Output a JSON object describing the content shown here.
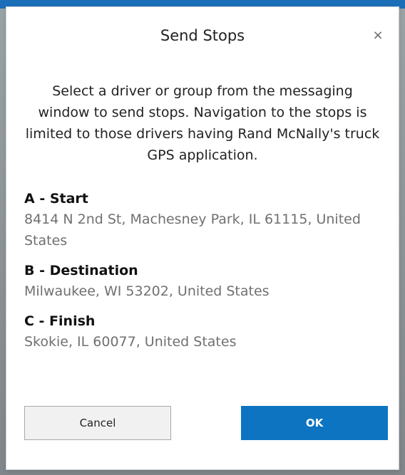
{
  "dialog": {
    "title": "Send Stops",
    "close_icon": "×",
    "message": "Select a driver or group from the messaging window to send stops. Navigation to the stops is limited to those drivers having Rand McNally's truck GPS application.",
    "stops": [
      {
        "label": "A - Start",
        "address": "8414 N 2nd St, Machesney Park, IL 61115, United States"
      },
      {
        "label": "B - Destination",
        "address": "Milwaukee, WI 53202, United States"
      },
      {
        "label": "C - Finish",
        "address": "Skokie, IL 60077, United States"
      }
    ],
    "buttons": {
      "cancel_label": "Cancel",
      "ok_label": "OK"
    }
  },
  "colors": {
    "primary": "#0d74c2",
    "top_bar": "#1b6fb8",
    "address_text": "#707070"
  },
  "icons": {
    "close": "close-icon"
  }
}
